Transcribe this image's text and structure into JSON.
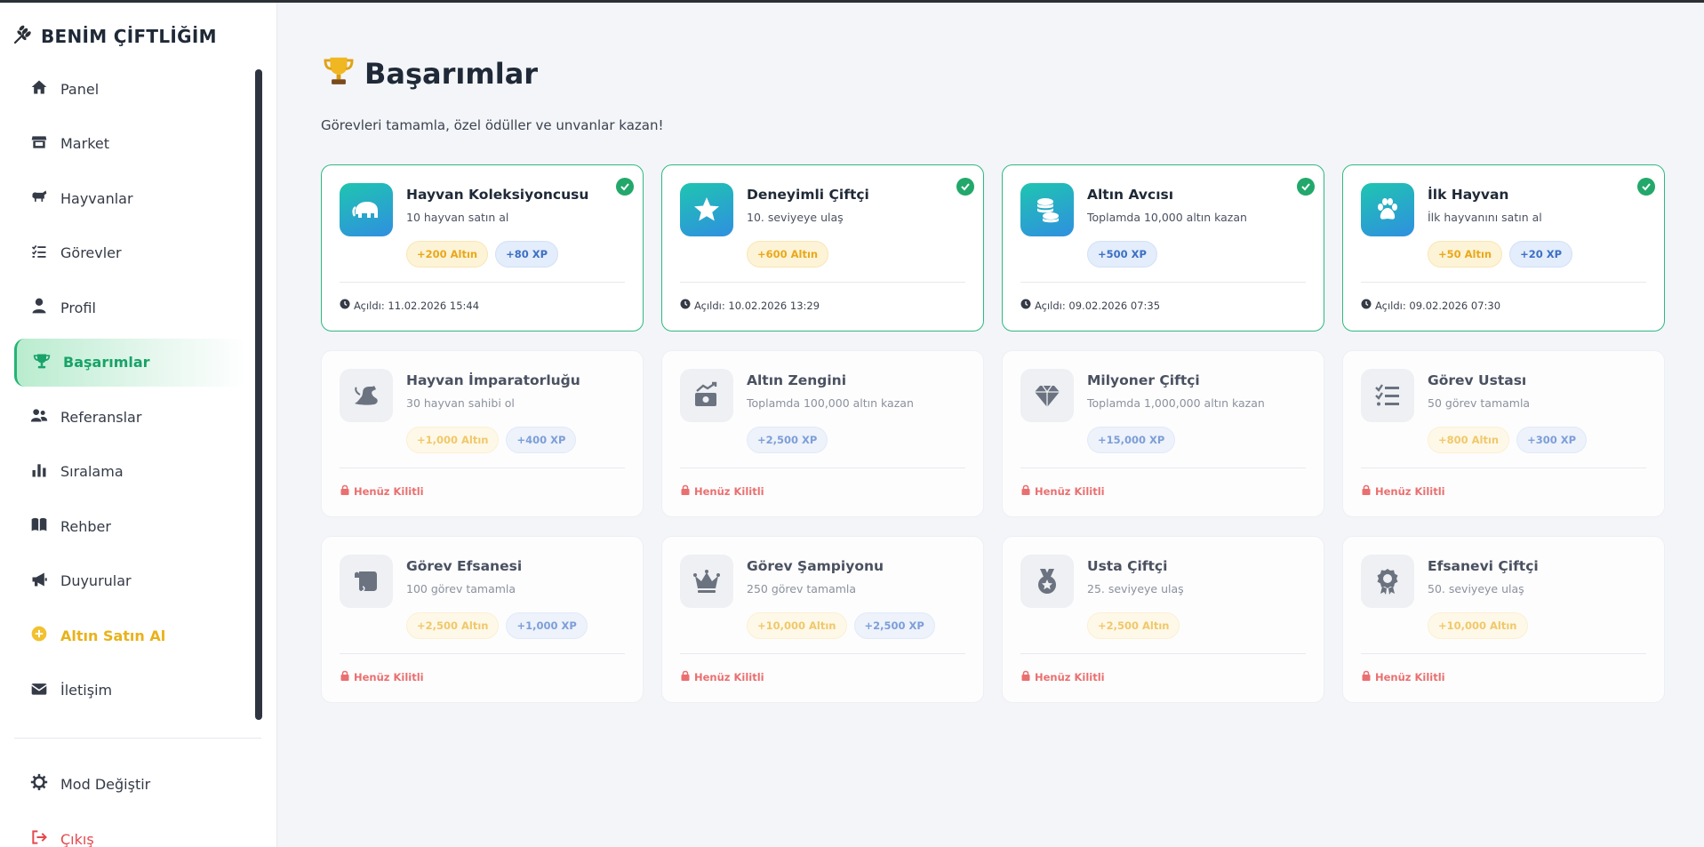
{
  "sidebar": {
    "brand": "BENİM ÇİFTLİĞİM",
    "items": [
      {
        "label": "Panel",
        "icon": "home-icon"
      },
      {
        "label": "Market",
        "icon": "store-icon"
      },
      {
        "label": "Hayvanlar",
        "icon": "horse-icon"
      },
      {
        "label": "Görevler",
        "icon": "list-check-icon"
      },
      {
        "label": "Profil",
        "icon": "user-icon"
      },
      {
        "label": "Başarımlar",
        "icon": "trophy-icon",
        "active": true
      },
      {
        "label": "Referanslar",
        "icon": "users-icon"
      },
      {
        "label": "Sıralama",
        "icon": "bar-chart-icon"
      },
      {
        "label": "Rehber",
        "icon": "book-icon"
      },
      {
        "label": "Duyurular",
        "icon": "megaphone-icon"
      },
      {
        "label": "Altın Satın Al",
        "icon": "coin-icon"
      },
      {
        "label": "İletişim",
        "icon": "envelope-icon"
      }
    ],
    "bottom": [
      {
        "label": "Mod Değiştir",
        "icon": "gear-icon"
      },
      {
        "label": "Çıkış",
        "icon": "sign-out-icon"
      }
    ]
  },
  "page": {
    "title": "Başarımlar",
    "subtitle": "Görevleri tamamla, özel ödüller ve unvanlar kazan!"
  },
  "achievements": [
    {
      "title": "Hayvan Koleksiyoncusu",
      "desc": "10 hayvan satın al",
      "gold": "+200 Altın",
      "xp": "+80 XP",
      "footer": "Açıldı: 11.02.2026 15:44"
    },
    {
      "title": "Deneyimli Çiftçi",
      "desc": "10. seviyeye ulaş",
      "gold": "+600 Altın",
      "footer": "Açıldı: 10.02.2026 13:29"
    },
    {
      "title": "Altın Avcısı",
      "desc": "Toplamda 10,000 altın kazan",
      "xp": "+500 XP",
      "footer": "Açıldı: 09.02.2026 07:35"
    },
    {
      "title": "İlk Hayvan",
      "desc": "İlk hayvanını satın al",
      "gold": "+50 Altın",
      "xp": "+20 XP",
      "footer": "Açıldı: 09.02.2026 07:30"
    },
    {
      "title": "Hayvan İmparatorluğu",
      "desc": "30 hayvan sahibi ol",
      "gold": "+1,000 Altın",
      "xp": "+400 XP",
      "footer": "Henüz Kilitli"
    },
    {
      "title": "Altın Zengini",
      "desc": "Toplamda 100,000 altın kazan",
      "xp": "+2,500 XP",
      "footer": "Henüz Kilitli"
    },
    {
      "title": "Milyoner Çiftçi",
      "desc": "Toplamda 1,000,000 altın kazan",
      "xp": "+15,000 XP",
      "footer": "Henüz Kilitli"
    },
    {
      "title": "Görev Ustası",
      "desc": "50 görev tamamla",
      "gold": "+800 Altın",
      "xp": "+300 XP",
      "footer": "Henüz Kilitli"
    },
    {
      "title": "Görev Efsanesi",
      "desc": "100 görev tamamla",
      "gold": "+2,500 Altın",
      "xp": "+1,000 XP",
      "footer": "Henüz Kilitli"
    },
    {
      "title": "Görev Şampiyonu",
      "desc": "250 görev tamamla",
      "gold": "+10,000 Altın",
      "xp": "+2,500 XP",
      "footer": "Henüz Kilitli"
    },
    {
      "title": "Usta Çiftçi",
      "desc": "25. seviyeye ulaş",
      "gold": "+2,500 Altın",
      "footer": "Henüz Kilitli"
    },
    {
      "title": "Efsanevi Çiftçi",
      "desc": "50. seviyeye ulaş",
      "gold": "+10,000 Altın",
      "footer": "Henüz Kilitli"
    }
  ],
  "colors": {
    "accent": "#22b573",
    "gold": "#e9b21a",
    "danger": "#e5484d",
    "xp": "#3d6fc4"
  }
}
